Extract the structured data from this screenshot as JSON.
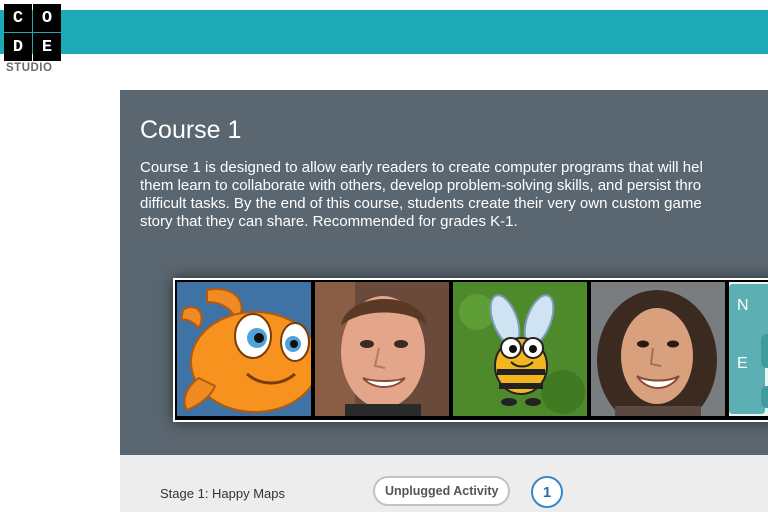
{
  "header": {
    "color": "#1ea9b6"
  },
  "logo": {
    "letters": [
      "C",
      "O",
      "D",
      "E"
    ],
    "subtitle": "STUDIO"
  },
  "course": {
    "title": "Course 1",
    "description_lines": [
      "Course 1 is designed to allow early readers to create computer programs that will hel",
      "them learn to collaborate with others, develop problem-solving skills, and persist thro",
      "difficult tasks. By the end of this course, students create their very own custom game",
      "story that they can share. Recommended for grades K-1."
    ],
    "background": "#5b6770"
  },
  "videos": [
    {
      "name": "fish-character",
      "icon": "orange-fish"
    },
    {
      "name": "man-portrait",
      "icon": "person-photo"
    },
    {
      "name": "bee-character",
      "icon": "cartoon-bee"
    },
    {
      "name": "woman-portrait",
      "icon": "person-photo"
    },
    {
      "name": "compass-blocks",
      "icon": "code-blocks"
    }
  ],
  "compass": {
    "north": "N",
    "east": "E"
  },
  "stage": {
    "label": "Stage 1: Happy Maps",
    "activity_button": "Unplugged Activity",
    "level_number": "1",
    "accent": "#3a87c8"
  }
}
